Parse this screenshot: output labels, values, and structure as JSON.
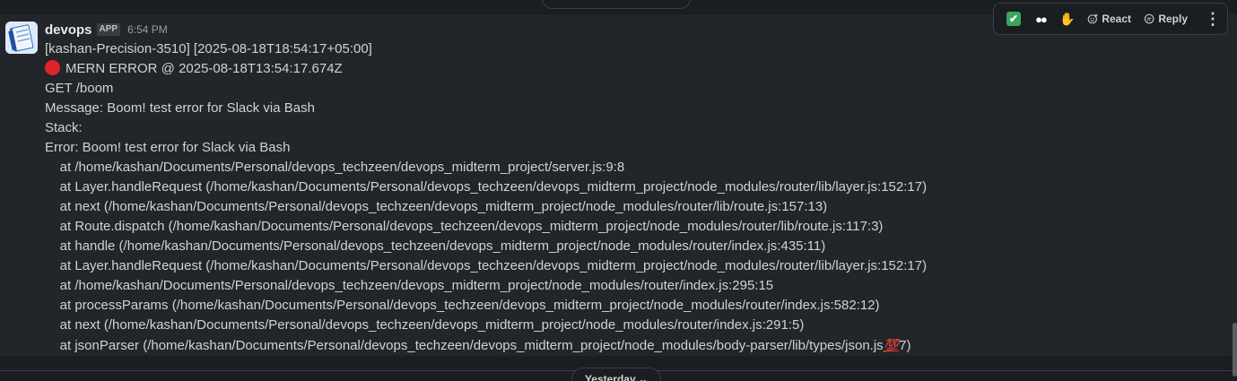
{
  "message": {
    "sender": "devops",
    "badge": "APP",
    "time": "6:54 PM",
    "lines": [
      "[kashan-Precision-3510] [2025-08-18T18:54:17+05:00]",
      "MERN ERROR @ 2025-08-18T13:54:17.674Z",
      "GET /boom",
      "Message: Boom! test error for Slack via Bash",
      "Stack:",
      "Error: Boom! test error for Slack via Bash",
      "    at /home/kashan/Documents/Personal/devops_techzeen/devops_midterm_project/server.js:9:8",
      "    at Layer.handleRequest (/home/kashan/Documents/Personal/devops_techzeen/devops_midterm_project/node_modules/router/lib/layer.js:152:17)",
      "    at next (/home/kashan/Documents/Personal/devops_techzeen/devops_midterm_project/node_modules/router/lib/route.js:157:13)",
      "    at Route.dispatch (/home/kashan/Documents/Personal/devops_techzeen/devops_midterm_project/node_modules/router/lib/route.js:117:3)",
      "    at handle (/home/kashan/Documents/Personal/devops_techzeen/devops_midterm_project/node_modules/router/index.js:435:11)",
      "    at Layer.handleRequest (/home/kashan/Documents/Personal/devops_techzeen/devops_midterm_project/node_modules/router/lib/layer.js:152:17)",
      "    at /home/kashan/Documents/Personal/devops_techzeen/devops_midterm_project/node_modules/router/index.js:295:15",
      "    at processParams (/home/kashan/Documents/Personal/devops_techzeen/devops_midterm_project/node_modules/router/index.js:582:12)",
      "    at next (/home/kashan/Documents/Personal/devops_techzeen/devops_midterm_project/node_modules/router/index.js:291:5)"
    ],
    "last_line_prefix": "    at jsonParser (/home/kashan/Documents/Personal/devops_techzeen/devops_midterm_project/node_modules/body-parser/lib/types/json.js",
    "last_line_emoji": "💯",
    "last_line_suffix": "7)"
  },
  "toolbar": {
    "react_label": "React",
    "reply_label": "Reply",
    "quick_reactions": [
      "white-check-mark",
      "eyes",
      "raised-hands"
    ]
  },
  "divider": {
    "label": "Yesterday ⌄"
  },
  "colors": {
    "background": "#1a1d21",
    "hover_row": "#222529",
    "stop_red": "#e0242a"
  }
}
